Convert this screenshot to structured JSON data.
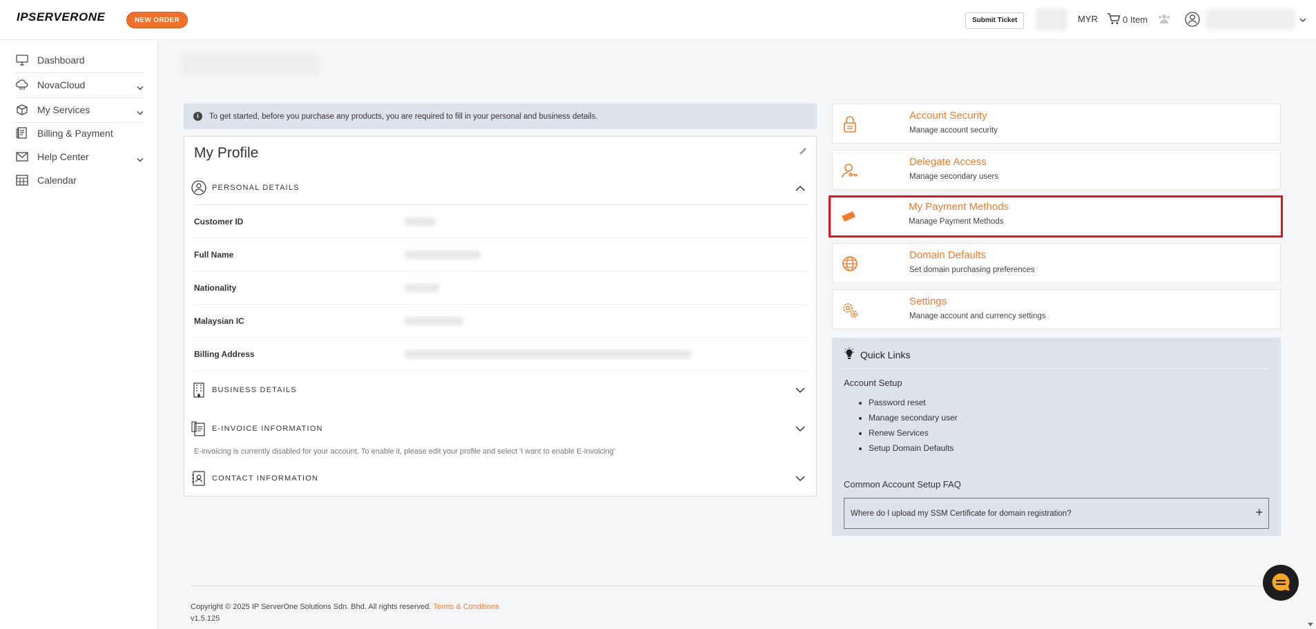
{
  "header": {
    "logo_text": "IPSERVERONE",
    "new_order_label": "NEW ORDER",
    "submit_ticket_label": "Submit Ticket",
    "currency": "MYR",
    "cart_label": "0 Item"
  },
  "sidebar": {
    "items": [
      {
        "label": "Dashboard",
        "icon": "monitor-icon"
      },
      {
        "label": "NovaCloud",
        "icon": "cloud-icon"
      },
      {
        "label": "My Services",
        "icon": "box-icon"
      },
      {
        "label": "Billing & Payment",
        "icon": "invoice-icon"
      },
      {
        "label": "Help Center",
        "icon": "mail-icon"
      },
      {
        "label": "Calendar",
        "icon": "calendar-icon"
      }
    ]
  },
  "info_banner": {
    "text": "To get started, before you purchase any products, you are required to fill in your personal and business details."
  },
  "profile": {
    "title": "My Profile",
    "personal_details_title": "PERSONAL DETAILS",
    "rows": [
      {
        "label": "Customer ID"
      },
      {
        "label": "Full Name"
      },
      {
        "label": "Nationality"
      },
      {
        "label": "Malaysian IC"
      },
      {
        "label": "Billing Address"
      }
    ],
    "business_details_title": "BUSINESS DETAILS",
    "einvoice_title": "E-INVOICE INFORMATION",
    "einvoice_note": "E-invoicing is currently disabled for your account. To enable it, please edit your profile and select 'I want to enable E-invoicing'",
    "contact_title": "CONTACT INFORMATION"
  },
  "account_cards": [
    {
      "title": "Account Security",
      "desc": "Manage account security",
      "icon": "lock-icon"
    },
    {
      "title": "Delegate Access",
      "desc": "Manage secondary users",
      "icon": "user-key-icon"
    },
    {
      "title": "My Payment Methods",
      "desc": "Manage Payment Methods",
      "icon": "credit-cards-icon"
    },
    {
      "title": "Domain Defaults",
      "desc": "Set domain purchasing preferences",
      "icon": "globe-icon"
    },
    {
      "title": "Settings",
      "desc": "Manage account and currency settings",
      "icon": "gears-icon"
    }
  ],
  "quick_links": {
    "title": "Quick Links",
    "subtitle": "Account Setup",
    "links": [
      "Password reset",
      "Manage secondary user",
      "Renew Services",
      "Setup Domain Defaults"
    ],
    "faq_title": "Common Account Setup FAQ",
    "faq_question": "Where do I upload my SSM Certificate for domain registration?"
  },
  "footer": {
    "copyright": "Copyright © 2025 IP ServerOne Solutions Sdn. Bhd. All rights reserved.",
    "terms_label": "Terms & Conditions",
    "version": "v1.5.125"
  },
  "colors": {
    "accent": "#ee7d2e",
    "highlight_border": "#e2141b"
  }
}
